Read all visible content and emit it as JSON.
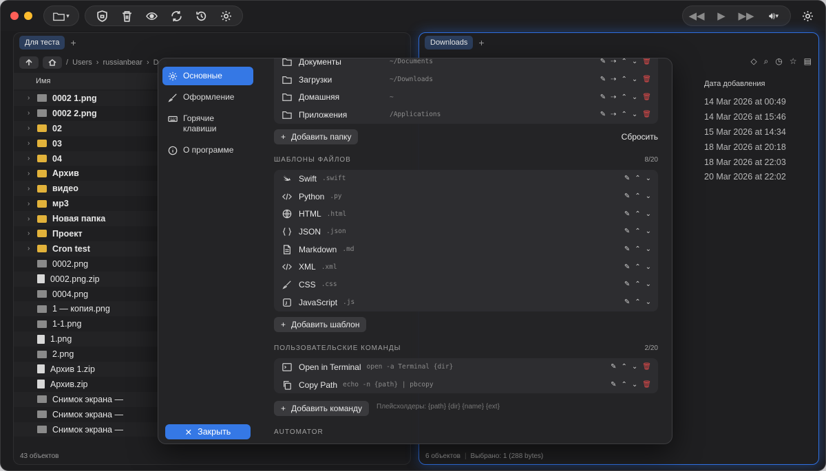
{
  "titlebar": {
    "icons": [
      "folder-icon",
      "shield-icon",
      "trash-icon",
      "eye-icon",
      "sync-icon",
      "history-icon",
      "gear-icon"
    ],
    "media_icons": [
      "rewind-icon",
      "play-icon",
      "fast-forward-icon",
      "volume-icon"
    ]
  },
  "left_pane": {
    "tab": "Для теста",
    "path": [
      "Users",
      "russianbear",
      "Des"
    ],
    "col_name": "Имя",
    "rows": [
      {
        "name": "0002 1.png",
        "kind": "img",
        "bold": true,
        "chev": true
      },
      {
        "name": "0002 2.png",
        "kind": "img",
        "bold": true,
        "chev": true
      },
      {
        "name": "02",
        "kind": "folder",
        "bold": true,
        "chev": true
      },
      {
        "name": "03",
        "kind": "folder",
        "bold": true,
        "chev": true
      },
      {
        "name": "04",
        "kind": "folder",
        "bold": true,
        "chev": true
      },
      {
        "name": "Архив",
        "kind": "folder",
        "bold": true,
        "chev": true
      },
      {
        "name": "видео",
        "kind": "folder",
        "bold": true,
        "chev": true
      },
      {
        "name": "мр3",
        "kind": "folder",
        "bold": true,
        "chev": true
      },
      {
        "name": "Новая папка",
        "kind": "folder",
        "bold": true,
        "chev": true
      },
      {
        "name": "Проект",
        "kind": "folder",
        "bold": true,
        "chev": true
      },
      {
        "name": "Cron test",
        "kind": "folder",
        "bold": true,
        "chev": true
      },
      {
        "name": "0002.png",
        "kind": "img",
        "bold": false,
        "chev": false
      },
      {
        "name": "0002.png.zip",
        "kind": "doc",
        "bold": false,
        "chev": false
      },
      {
        "name": "0004.png",
        "kind": "img",
        "bold": false,
        "chev": false
      },
      {
        "name": "1 — копия.png",
        "kind": "img",
        "bold": false,
        "chev": false
      },
      {
        "name": "1-1.png",
        "kind": "img",
        "bold": false,
        "chev": false
      },
      {
        "name": "1.png",
        "kind": "doc",
        "bold": false,
        "chev": false
      },
      {
        "name": "2.png",
        "kind": "img",
        "bold": false,
        "chev": false
      },
      {
        "name": "Архив 1.zip",
        "kind": "doc",
        "bold": false,
        "chev": false
      },
      {
        "name": "Архив.zip",
        "kind": "doc",
        "bold": false,
        "chev": false
      },
      {
        "name": "Снимок экрана —",
        "kind": "img",
        "bold": false,
        "chev": false
      },
      {
        "name": "Снимок экрана —",
        "kind": "img",
        "bold": false,
        "chev": false
      },
      {
        "name": "Снимок экрана —",
        "kind": "img",
        "bold": false,
        "chev": false
      }
    ],
    "status": "43 объектов"
  },
  "right_pane": {
    "tab": "Downloads",
    "col_date": "Дата добавления",
    "dates": [
      "14 Mar 2026 at 00:49",
      "14 Mar 2026 at 15:46",
      "15 Mar 2026 at 14:34",
      "18 Mar 2026 at 20:18",
      "18 Mar 2026 at 22:03",
      "20 Mar 2026 at 22:02"
    ],
    "status_count": "6 объектов",
    "status_selected": "Выбрано: 1 (288 bytes)"
  },
  "settings": {
    "nav": [
      {
        "label": "Основные",
        "icon": "gear-icon",
        "active": true
      },
      {
        "label": "Оформление",
        "icon": "brush-icon",
        "active": false
      },
      {
        "label": "Горячие клавиши",
        "icon": "keyboard-icon",
        "active": false
      },
      {
        "label": "О программе",
        "icon": "info-icon",
        "active": false
      }
    ],
    "close_label": "Закрыть",
    "folders": [
      {
        "name": "Документы",
        "path": "~/Documents"
      },
      {
        "name": "Загрузки",
        "path": "~/Downloads"
      },
      {
        "name": "Домашняя",
        "path": "~"
      },
      {
        "name": "Приложения",
        "path": "/Applications"
      }
    ],
    "add_folder_label": "Добавить папку",
    "reset_label": "Сбросить",
    "templates_title": "ШАБЛОНЫ ФАЙЛОВ",
    "templates_count": "8/20",
    "templates": [
      {
        "name": "Swift",
        "ext": ".swift",
        "icon": "swift-icon"
      },
      {
        "name": "Python",
        "ext": ".py",
        "icon": "code-icon"
      },
      {
        "name": "HTML",
        "ext": ".html",
        "icon": "globe-icon"
      },
      {
        "name": "JSON",
        "ext": ".json",
        "icon": "braces-icon"
      },
      {
        "name": "Markdown",
        "ext": ".md",
        "icon": "document-icon"
      },
      {
        "name": "XML",
        "ext": ".xml",
        "icon": "code-icon"
      },
      {
        "name": "CSS",
        "ext": ".css",
        "icon": "brush-icon"
      },
      {
        "name": "JavaScript",
        "ext": ".js",
        "icon": "js-icon"
      }
    ],
    "add_template_label": "Добавить шаблон",
    "commands_title": "ПОЛЬЗОВАТЕЛЬСКИЕ КОМАНДЫ",
    "commands_count": "2/20",
    "commands": [
      {
        "name": "Open in Terminal",
        "cmd": "open -a Terminal {dir}",
        "icon": "terminal-icon"
      },
      {
        "name": "Copy Path",
        "cmd": "echo -n {path} | pbcopy",
        "icon": "copy-icon"
      }
    ],
    "add_command_label": "Добавить команду",
    "placeholders_hint": "Плейсхолдеры: {path} {dir} {name} {ext}",
    "automator_title": "AUTOMATOR"
  }
}
